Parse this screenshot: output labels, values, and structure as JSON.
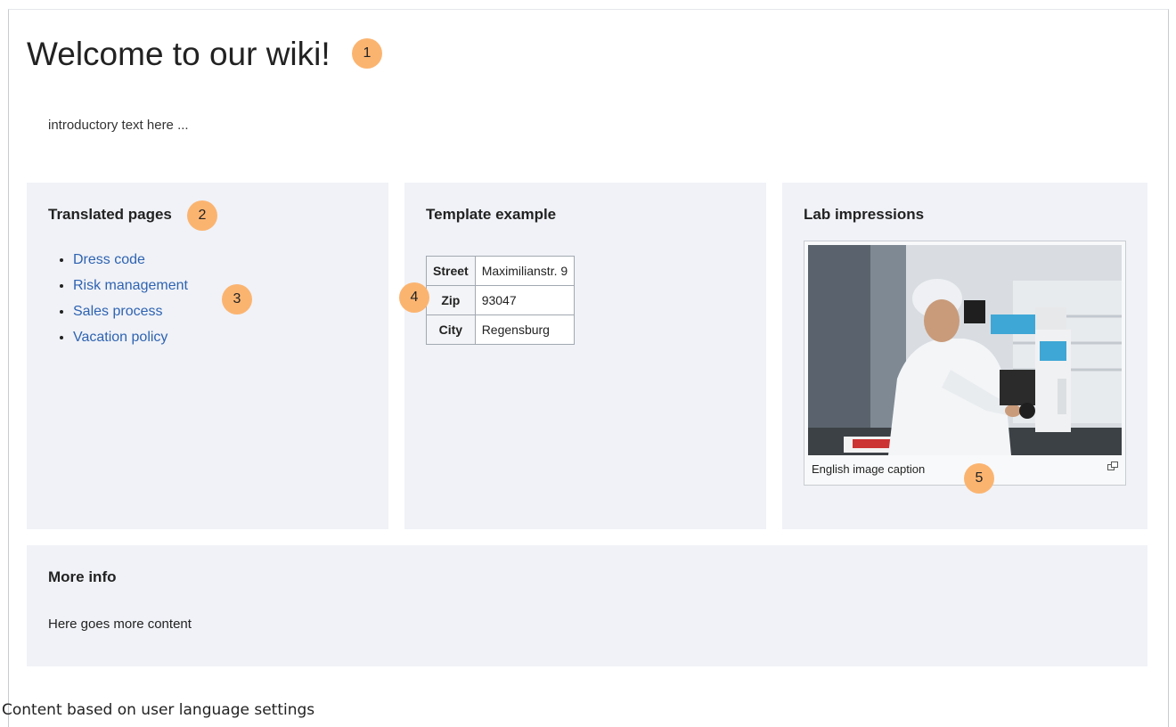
{
  "page": {
    "title": "Welcome to our wiki!",
    "intro": "introductory text here ..."
  },
  "markers": [
    "1",
    "2",
    "3",
    "4",
    "5"
  ],
  "translated_pages": {
    "heading": "Translated pages",
    "links": [
      "Dress code",
      "Risk management",
      "Sales process",
      "Vacation policy"
    ]
  },
  "template_example": {
    "heading": "Template example",
    "rows": [
      {
        "key": "Street",
        "value": "Maximilianstr. 9"
      },
      {
        "key": "Zip",
        "value": "93047"
      },
      {
        "key": "City",
        "value": "Regensburg"
      }
    ]
  },
  "lab_impressions": {
    "heading": "Lab impressions",
    "caption": "English image caption",
    "enlarge_icon": "enlarge-icon"
  },
  "more_info": {
    "heading": "More info",
    "text": "Here goes more content"
  },
  "footer": {
    "caption": "Content based on user language settings"
  },
  "colors": {
    "marker": "#fbb470",
    "panel_bg": "#f0f2f7",
    "link": "#2f63b1"
  }
}
